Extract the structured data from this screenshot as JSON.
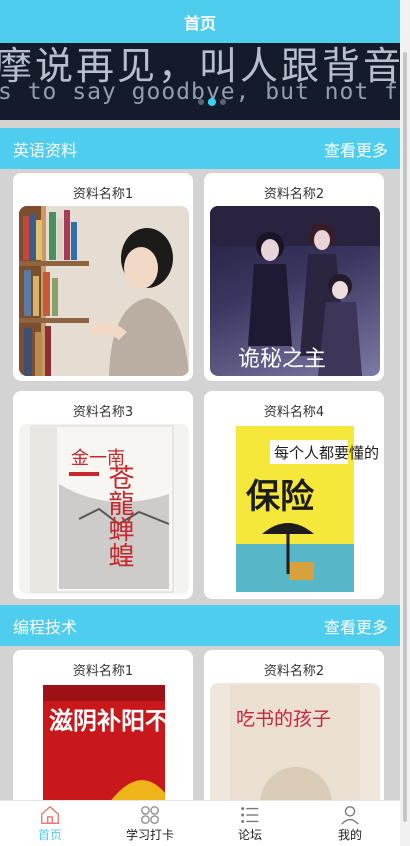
{
  "header": {
    "title": "首页"
  },
  "banner": {
    "line1": "摩说再见，叫人跟背音",
    "line2": "s to say goodbye, but not forewe",
    "dots": [
      false,
      true,
      false
    ]
  },
  "sections": [
    {
      "title": "英语资料",
      "more": "查看更多",
      "cards": [
        {
          "name": "资料名称1"
        },
        {
          "name": "资料名称2",
          "overlay": "诡秘之主"
        },
        {
          "name": "资料名称3",
          "book_title": "苍龍蝉蝗",
          "author": "金一南"
        },
        {
          "name": "资料名称4",
          "book_title": "每个人都要懂的保险"
        }
      ]
    },
    {
      "title": "编程技术",
      "more": "查看更多",
      "cards": [
        {
          "name": "资料名称1",
          "book_title": "滋阴补阳不生病"
        },
        {
          "name": "资料名称2",
          "book_title": "吃书的孩子"
        }
      ]
    }
  ],
  "nav": [
    {
      "label": "首页",
      "icon": "home-icon",
      "active": true
    },
    {
      "label": "学习打卡",
      "icon": "grid-icon",
      "active": false
    },
    {
      "label": "论坛",
      "icon": "list-icon",
      "active": false
    },
    {
      "label": "我的",
      "icon": "user-icon",
      "active": false
    }
  ]
}
